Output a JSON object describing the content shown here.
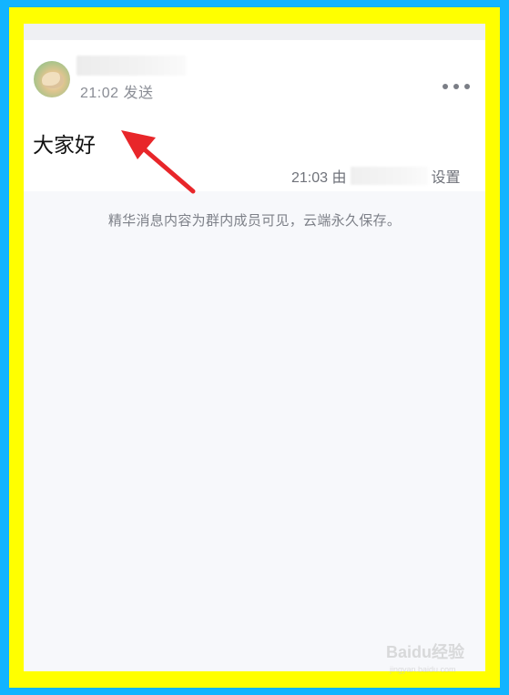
{
  "message": {
    "send_time": "21:02 发送",
    "text": "大家好",
    "set_prefix": "21:03 由",
    "set_suffix": "设置"
  },
  "note": "精华消息内容为群内成员可见，云端永久保存。",
  "watermark": {
    "text": "Baidu经验",
    "sub": "jingyan.baidu.com"
  },
  "colors": {
    "outer_border": "#12b4ff",
    "inner_border": "#ffff00",
    "arrow": "#e8262a"
  },
  "icons": {
    "more": "more-dots-icon",
    "avatar": "hamster-avatar"
  }
}
